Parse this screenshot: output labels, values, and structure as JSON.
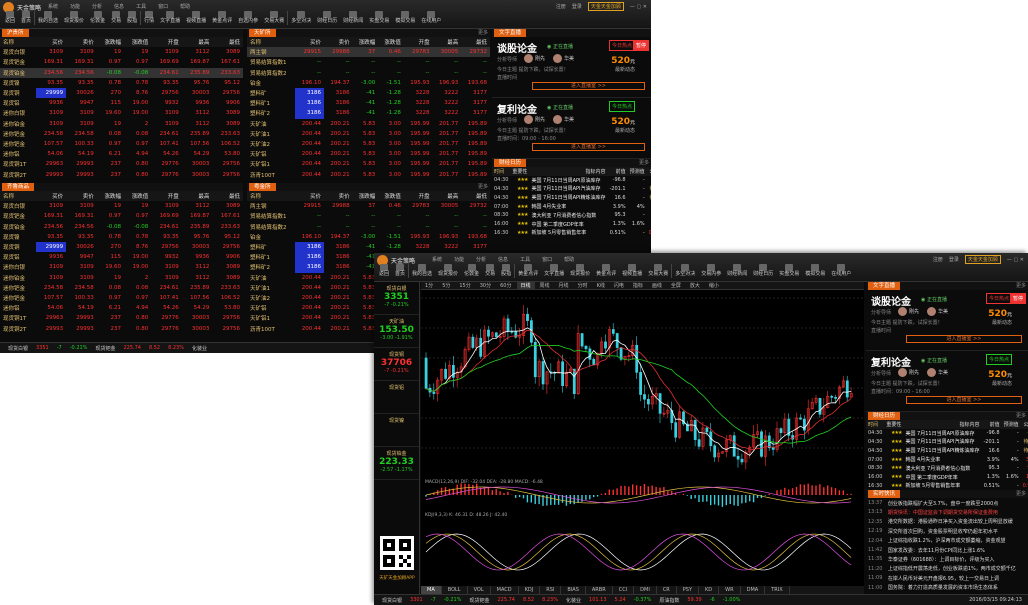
{
  "app_name": "天金策略",
  "menu": [
    "系统",
    "功能",
    "分析",
    "信息",
    "工具",
    "窗口",
    "帮助"
  ],
  "login": [
    "注册",
    "登录"
  ],
  "account_badge": "天金天金加顾",
  "w1": {
    "toolbar": [
      "返回",
      "首页",
      "我的自选",
      "现货报价",
      "伦敦金",
      "交易",
      "股指",
      "行情",
      "文字直播",
      "视频直播",
      "黄金点评",
      "自选内参",
      "交易大赛",
      "多空对决",
      "财经日历",
      "财经新闻",
      "实盘交易",
      "模拟交易",
      "在线用户"
    ],
    "panel_tl": {
      "tab": "沪贵所",
      "more": ""
    },
    "panel_tr": {
      "tab": "天矿所",
      "more": "更多"
    },
    "panel_bl": {
      "tab": "齐鲁商品",
      "more": ""
    },
    "panel_br": {
      "tab": "粤金所",
      "more": "更多"
    },
    "headers_left": [
      "名称",
      "买价",
      "卖价",
      "涨跌幅",
      "涨跌值",
      "开盘",
      "最高",
      "最低"
    ],
    "headers_right": [
      "名称",
      "买价",
      "卖价",
      "涨跌幅",
      "涨跌值",
      "开盘",
      "最高",
      "最低"
    ],
    "rows_left": [
      [
        "现货白银",
        "3109",
        "3109",
        "19",
        "19",
        "3109",
        "3112",
        "3089"
      ],
      [
        "现货钯金",
        "169.31",
        "169.31",
        "0.97",
        "0.97",
        "169.69",
        "169.87",
        "167.61"
      ],
      [
        "现货铂金",
        "234.56",
        "234.56",
        "-0.08",
        "-0.08",
        "234.61",
        "235.89",
        "233.63"
      ],
      [
        "现货镍",
        "93.35",
        "93.35",
        "0.78",
        "0.78",
        "93.35",
        "95.76",
        "95.12"
      ],
      [
        "现货铜",
        "29999",
        "30026",
        "270",
        "8.76",
        "29756",
        "30003",
        "29756"
      ],
      [
        "现货铝",
        "9936",
        "9947",
        "115",
        "19.00",
        "9932",
        "9936",
        "9906"
      ],
      [
        "迷你白银",
        "3109",
        "3109",
        "19.60",
        "19.00",
        "3109",
        "3112",
        "3089"
      ],
      [
        "迷你铂金",
        "3109",
        "3109",
        "19",
        "2",
        "3109",
        "3112",
        "3089"
      ],
      [
        "迷你钯金",
        "234.58",
        "234.58",
        "0.08",
        "0.08",
        "234.61",
        "235.89",
        "233.63"
      ],
      [
        "迷你钯金",
        "107.57",
        "100.33",
        "0.97",
        "0.97",
        "107.41",
        "107.56",
        "106.52"
      ],
      [
        "迷你铝",
        "54.06",
        "54.19",
        "6.21",
        "4.94",
        "54.26",
        "54.29",
        "53.80"
      ],
      [
        "现货铜1T",
        "29963",
        "29993",
        "237",
        "0.80",
        "29776",
        "30003",
        "29756"
      ],
      [
        "现货铜2T",
        "29993",
        "29993",
        "237",
        "0.80",
        "29776",
        "30003",
        "29756"
      ]
    ],
    "rows_right": [
      [
        "两主钢",
        "29915",
        "29988",
        "37",
        "0.46",
        "29783",
        "30005",
        "29732"
      ],
      [
        "贸易结算指数1",
        "--",
        "--",
        "--",
        "--",
        "--",
        "--",
        "--"
      ],
      [
        "贸易结算指数2",
        "--",
        "--",
        "--",
        "--",
        "--",
        "--",
        "--"
      ],
      [
        "铂金",
        "196.10",
        "194.37",
        "-3.00",
        "-1.51",
        "195.93",
        "196.93",
        "193.68"
      ],
      [
        "塑料矿",
        "3186",
        "3186",
        "-41",
        "-1.28",
        "3228",
        "3222",
        "3177"
      ],
      [
        "塑料矿1",
        "3186",
        "3186",
        "-41",
        "-1.28",
        "3228",
        "3222",
        "3177"
      ],
      [
        "塑料矿2",
        "3186",
        "3186",
        "-41",
        "-1.28",
        "3228",
        "3222",
        "3177"
      ],
      [
        "天矿油",
        "200.44",
        "200.21",
        "5.83",
        "3.00",
        "195.99",
        "201.77",
        "195.89"
      ],
      [
        "天矿油1",
        "200.44",
        "200.21",
        "5.83",
        "3.00",
        "195.99",
        "201.77",
        "195.89"
      ],
      [
        "天矿油2",
        "200.44",
        "200.21",
        "5.83",
        "3.00",
        "195.99",
        "201.77",
        "195.89"
      ],
      [
        "天矿铝",
        "200.44",
        "200.21",
        "5.83",
        "3.00",
        "195.99",
        "201.77",
        "195.89"
      ],
      [
        "天矿铝1",
        "200.44",
        "200.21",
        "5.83",
        "3.00",
        "195.99",
        "201.77",
        "195.89"
      ],
      [
        "沥青100T",
        "200.44",
        "200.21",
        "5.83",
        "3.00",
        "195.99",
        "201.77",
        "195.89"
      ]
    ],
    "status": [
      "现货白银",
      "3351",
      "-7",
      "-0.21%",
      "现货钯金",
      "225.74",
      "8.52",
      "8.23%",
      "化装业"
    ]
  },
  "live_cards": [
    {
      "title": "谈股论金",
      "live": "正在直播",
      "hosts_label": "分析导师",
      "hosts": [
        "刚先",
        "华美"
      ],
      "today": "今日主题",
      "topic": "提防下跌，试探长置！",
      "time": "直播时间",
      "badge": "今日热点",
      "badge2": "暂停",
      "price": "520",
      "unit": "元",
      "sub": "最新动态",
      "enter": "进入直播室 >>"
    },
    {
      "title": "复利论金",
      "live": "正在直播",
      "hosts_label": "分析导师",
      "hosts": [
        "刚先",
        "华美"
      ],
      "today": "今日主题",
      "topic": "提防下跌，试探长置！",
      "time": "直播时间：09:00 - 16:00",
      "badge": "今日热点",
      "badge2": "",
      "price": "520",
      "unit": "元",
      "sub": "最新动态",
      "enter": "进入直播室 >>"
    }
  ],
  "calendar": {
    "tab": "财经日历",
    "more": "更多",
    "headers": [
      "时间",
      "重要性",
      "指标内容",
      "前值",
      "预测值",
      "公布值"
    ],
    "rows": [
      [
        "04:30",
        "3",
        "美国 7月11日当周API原油库存",
        "-96.8",
        "-",
        "-736"
      ],
      [
        "04:30",
        "3",
        "美国 7月11日当周API汽油库存",
        "-201.1",
        "-",
        "待公布"
      ],
      [
        "04:30",
        "3",
        "美国 7月11日当周API精炼油库存",
        "16.6",
        "-",
        "待公布"
      ],
      [
        "07:00",
        "3",
        "韩国 4月失业率",
        "3.9%",
        "4%",
        "3.9%"
      ],
      [
        "08:30",
        "3",
        "澳大利亚 7月消费者信心指数",
        "95.3",
        "-",
        "92.2"
      ],
      [
        "16:00",
        "3",
        "中国 第二季度GDP年率",
        "1.3%",
        "1.6%",
        "1.7%"
      ],
      [
        "16:30",
        "3",
        "新加坡 5月零售销售年率",
        "0.51%",
        "-",
        "0.95%"
      ]
    ]
  },
  "w2": {
    "toolbar": [
      "返回",
      "首页",
      "我的自选",
      "现货报价",
      "伦敦金",
      "交易",
      "股指",
      "黄金点评",
      "文字直播",
      "现货报价",
      "黄金点评",
      "视频直播",
      "交易大赛",
      "多空对决",
      "交易内参",
      "财经新闻",
      "财经日历",
      "实盘交易",
      "模拟交易",
      "在线用户"
    ],
    "side_quotes": [
      {
        "name": "现货白银",
        "value": "3351",
        "change": "-7",
        "pct": "-0.21%",
        "color": "#20d020"
      },
      {
        "name": "天矿油",
        "value": "153.50",
        "change": "-3.00",
        "pct": "-1.91%",
        "color": "#20d020"
      },
      {
        "name": "现货铜",
        "value": "37706",
        "change": "-7",
        "pct": "-0.21%",
        "color": "#ff3030"
      },
      {
        "name": "现货铝",
        "value": "",
        "change": "",
        "pct": "",
        "color": "#ff3030"
      },
      {
        "name": "现货镍",
        "value": "",
        "change": "",
        "pct": "",
        "color": "#ff3030"
      },
      {
        "name": "现货铂金",
        "value": "223.33",
        "change": "-2.57",
        "pct": "-1.17%",
        "color": "#20d020"
      }
    ],
    "qr_caption": "天矿天金加顾APP",
    "chart_tabs": [
      "1分",
      "5分",
      "15分",
      "30分",
      "60分",
      "日线",
      "周线",
      "月线",
      "分时",
      "K线",
      "闪电",
      "指标",
      "画线",
      "全屏",
      "放大",
      "缩小"
    ],
    "macd_label": "MACD(12,26,9) DIF: -32.04 DEA: -28.80 MACD: -6.48",
    "kdj_label": "KDJ(9,3,3) K: 46.31 D: 48.26 J: 42.40",
    "indicators": [
      "MA",
      "BOLL",
      "VOL",
      "MACD",
      "KDJ",
      "RSI",
      "BIAS",
      "ARBR",
      "CCI",
      "DMI",
      "CR",
      "PSY",
      "KD",
      "WR",
      "DMA",
      "TRIX"
    ],
    "news_tab": "实时快讯",
    "news": [
      [
        "13:37",
        "创业板指跌幅扩大至3.7%，盘中一度跌至2000点"
      ],
      [
        "13:13",
        "期货快讯：中国证监会下调期货交易所保证金费用"
      ],
      [
        "12:35",
        "港交所数据：港股通昨日净买入资金流出较上周明显放缓"
      ],
      [
        "12:19",
        "深交所首次回购，资金股票明显收窄仍超年初水平"
      ],
      [
        "12:04",
        "上证综指收跌1.2%，沪深两市成交额萎缩，资金观望"
      ],
      [
        "11:42",
        "国家发改委：去年11月份CPI同比上涨1.6%"
      ],
      [
        "11:35",
        "华泰证券（601688）：上调目标价，评级为买入"
      ],
      [
        "11:20",
        "上证综指低开震荡走低，创业板跌逾1%，两市成交额千亿"
      ],
      [
        "11:09",
        "在岸人民币对美元开盘报6.95，较上一交易日上调"
      ],
      [
        "11:00",
        "国务院：着力打造高质量发展的资本市场生态体系"
      ]
    ],
    "status": [
      "现货白银",
      "3301",
      "-7",
      "-0.21%",
      "现货钯金",
      "225.74",
      "8.52",
      "8.23%",
      "化装业",
      "101.13",
      "5.24",
      "-0.37%",
      "原油指数",
      "59.39",
      "-6",
      "-1.00%"
    ],
    "datetime": "2016/03/15 09:24:13"
  },
  "chart_data": {
    "type": "candlestick",
    "title": "",
    "series": [],
    "note_hidden": ""
  }
}
